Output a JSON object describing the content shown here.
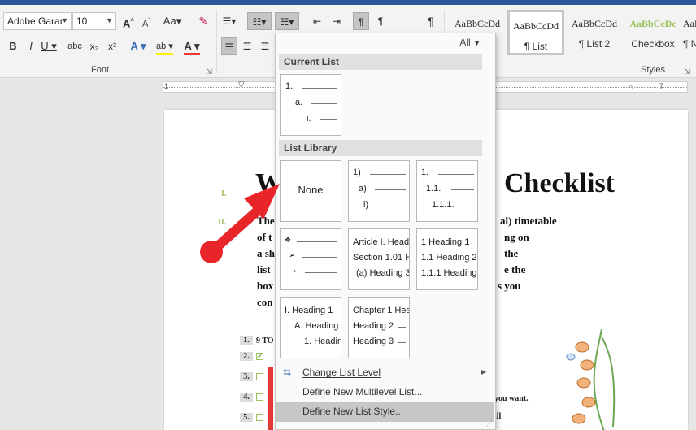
{
  "ribbon": {
    "font_name": "Adobe Garar",
    "font_size": "10",
    "font_group_label": "Font",
    "styles_group_label": "Styles",
    "styles": [
      {
        "sample": "AaBbCcDd",
        "name": "",
        "active": false
      },
      {
        "sample": "AaBbCcDd",
        "name": "¶ List",
        "active": true
      },
      {
        "sample": "AaBbCcDd",
        "name": "¶ List 2",
        "active": false
      },
      {
        "sample": "AaBbCcDc",
        "name": "Checkbox",
        "active": false
      },
      {
        "sample": "AaBbCcDc",
        "name": "¶ N",
        "active": false
      }
    ]
  },
  "ruler": {
    "numbers": [
      "1",
      "7"
    ]
  },
  "document": {
    "title_left": "W",
    "title_right": "Checklist",
    "roman_1": "I.",
    "roman_2": "II.",
    "para_lines": [
      {
        "left": "The",
        "right": "al) timetable"
      },
      {
        "left": "of t",
        "right": "ng on"
      },
      {
        "left": "a sh",
        "right": "the"
      },
      {
        "left": "list",
        "right": "e the"
      },
      {
        "left": "box",
        "right": "s you"
      },
      {
        "left": "con",
        "right": ""
      }
    ],
    "numbers": [
      "1.",
      "2.",
      "3.",
      "4.",
      "5."
    ],
    "first_item": "9 TO",
    "snippet_1": "you want.",
    "snippet_2": "ill"
  },
  "menu": {
    "filter_label": "All",
    "current_list_header": "Current List",
    "list_library_header": "List Library",
    "current": {
      "lines": [
        "1.",
        "a.",
        "i."
      ]
    },
    "library": [
      {
        "kind": "none",
        "label": "None"
      },
      {
        "kind": "lines",
        "lines": [
          "1)",
          "a)",
          "i)"
        ]
      },
      {
        "kind": "lines",
        "lines": [
          "1.",
          "1.1.",
          "1.1.1."
        ]
      },
      {
        "kind": "bullets",
        "lines": [
          "❖",
          "➢",
          "▪"
        ]
      },
      {
        "kind": "text",
        "lines": [
          "Article I. Headi",
          "Section 1.01 H",
          "(a) Heading 3"
        ]
      },
      {
        "kind": "text",
        "lines": [
          "1 Heading 1",
          "1.1 Heading 2",
          "1.1.1 Heading"
        ]
      },
      {
        "kind": "text",
        "lines": [
          "I. Heading 1",
          "A. Heading 2",
          "1. Headin"
        ]
      },
      {
        "kind": "text",
        "lines": [
          "Chapter 1 Hea",
          "Heading 2",
          "Heading 3"
        ]
      }
    ],
    "items": [
      {
        "label": "Change List Level",
        "icon": "change-list-level-icon",
        "submenu": true
      },
      {
        "label": "Define New Multilevel List...",
        "icon": "",
        "submenu": false
      },
      {
        "label": "Define New List Style...",
        "icon": "",
        "submenu": false
      }
    ]
  }
}
